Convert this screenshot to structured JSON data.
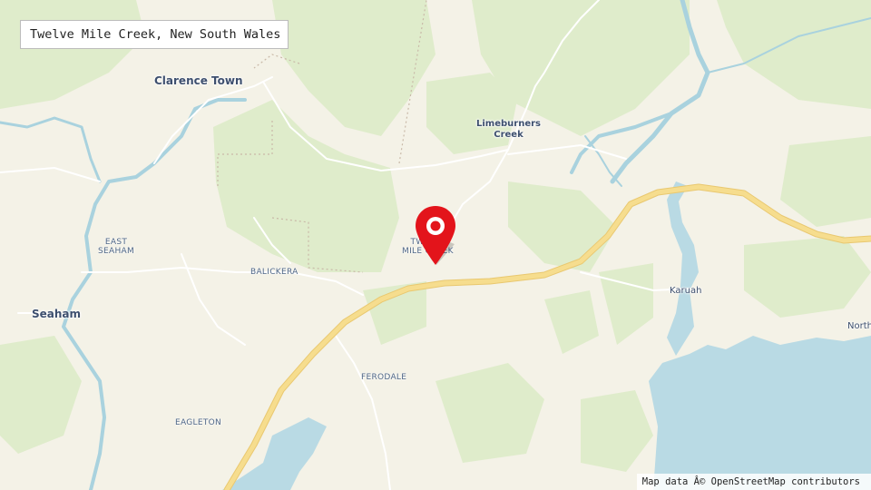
{
  "map": {
    "title": "Twelve Mile Creek, New South Wales",
    "attribution": "Map data Â© OpenStreetMap contributors",
    "marker_icon": "map-pin-icon",
    "colors": {
      "land": "#f4f2e7",
      "forest": "#dfeccb",
      "water": "#b9dae4",
      "river": "#a9d2de",
      "highway": "#f6dd8e",
      "road": "#ffffff",
      "marker": "#e3141b",
      "label_text": "#3d4f6e"
    },
    "places": {
      "clarence_town": "Clarence Town",
      "limeburners_line1": "Limeburners",
      "limeburners_line2": "Creek",
      "east_seaham_line1": "EAST",
      "east_seaham_line2": "SEAHAM",
      "twelve_mile_line1": "TWELVE",
      "twelve_mile_line2": "MILE CREEK",
      "balickera": "BALICKERA",
      "seaham": "Seaham",
      "karuah": "Karuah",
      "north": "North",
      "ferodale": "FERODALE",
      "eagleton": "EAGLETON"
    }
  }
}
